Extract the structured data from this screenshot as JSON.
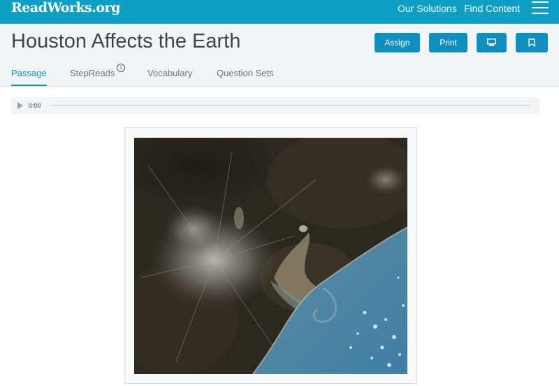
{
  "header": {
    "logo": "ReadWorks.org",
    "nav": [
      "Our Solutions",
      "Find Content"
    ],
    "menu_icon": "hamburger-menu-icon"
  },
  "article": {
    "title": "Houston Affects the Earth",
    "buttons": {
      "assign": "Assign",
      "print": "Print",
      "present_icon": "monitor-icon",
      "bookmark_icon": "bookmark-icon"
    }
  },
  "tabs": {
    "passage": "Passage",
    "stepreads": "StepReads",
    "stepreads_info": "i",
    "vocabulary": "Vocabulary",
    "question_sets": "Question Sets",
    "active": "Passage"
  },
  "audio": {
    "time": "0:00",
    "play_icon": "play-icon"
  },
  "colors": {
    "brand": "#0e9fc7",
    "accent": "#0e8fbf",
    "title_bar": "#f2f5f7"
  }
}
